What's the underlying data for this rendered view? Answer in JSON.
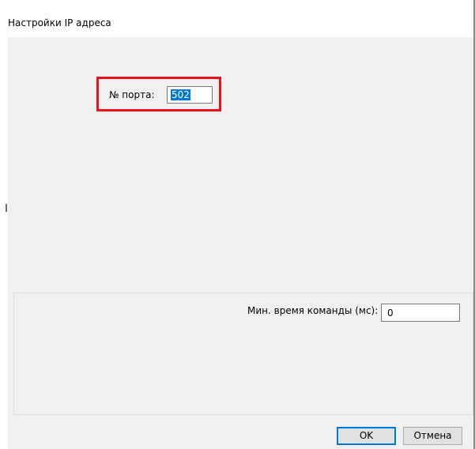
{
  "window": {
    "title": "Настройки IP адреса"
  },
  "port": {
    "label": "№ порта:",
    "value": "502"
  },
  "command": {
    "label": "Мин. время команды (мс):",
    "value": "0"
  },
  "buttons": {
    "ok": "OK",
    "cancel": "Отмена"
  },
  "colors": {
    "highlight_border": "#e8141c",
    "selection": "#0078d7",
    "dialog_background": "#f0f0f0"
  }
}
